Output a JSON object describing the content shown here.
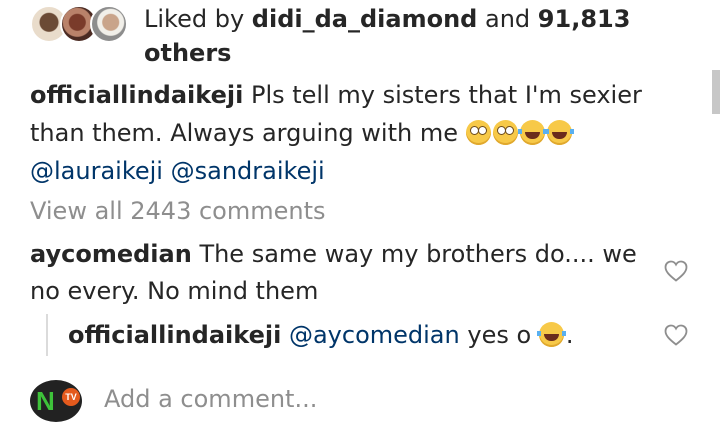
{
  "likes": {
    "prefix": "Liked by",
    "user": "didi_da_diamond",
    "and": "and",
    "count": "91,813",
    "suffix": "others"
  },
  "caption": {
    "username": "officiallindaikeji",
    "text": "Pls tell my sisters that I'm sexier than them. Always arguing with me",
    "emojis": [
      "face-with-rolling-eyes",
      "face-with-rolling-eyes",
      "face-with-tears-of-joy",
      "face-with-tears-of-joy"
    ],
    "mentions": [
      "@lauraikeji",
      "@sandraikeji"
    ]
  },
  "view_all": "View all 2443 comments",
  "comments": [
    {
      "username": "aycomedian",
      "text": "The same way my brothers do.... we no every. No mind them",
      "icon": "heart-icon"
    }
  ],
  "reply": {
    "username": "officiallindaikeji",
    "mention": "@aycomedian",
    "text": "yes o",
    "emoji": "rolling-on-the-floor-laughing",
    "trailing": ".",
    "icon": "heart-icon"
  },
  "add_comment": {
    "placeholder": "Add a comment...",
    "avatar_label": "TV"
  },
  "colors": {
    "mention": "#003569",
    "muted": "#8e8e8e",
    "text": "#262626"
  }
}
